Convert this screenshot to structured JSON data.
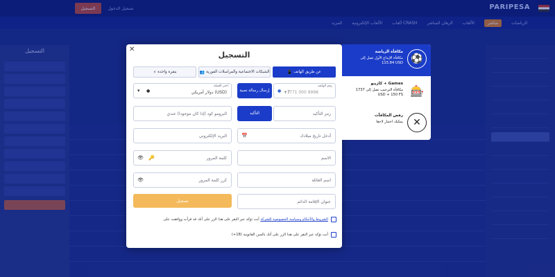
{
  "header": {
    "brand": "PARIPESA",
    "signup_label": "التسجيل",
    "login_label": "تسجيل الدخول"
  },
  "nav": {
    "items": [
      "الرياضات",
      "مباشر",
      "الألعاب",
      "الرهان المباشر",
      "ألعاب CRASH",
      "الألعاب الإلكترونية",
      "المزيد"
    ],
    "accent": "#d9822b"
  },
  "left_panel": {
    "title": "التسجيل"
  },
  "modal": {
    "title": "التسجيل",
    "close_icon": "close-icon",
    "tabs": [
      {
        "label": "عن طريق الهاتف",
        "icon": "phone-icon",
        "active": true
      },
      {
        "label": "الشبكات الاجتماعية والمراسلات الفورية",
        "icon": "users-icon",
        "active": false
      },
      {
        "label": "بنقرة واحدة",
        "icon": "bolt-icon",
        "active": false
      }
    ],
    "phone": {
      "label": "رقم الهاتف",
      "placeholder": "771 000 9998",
      "code": "+7"
    },
    "send_sms_label": "إرسال رسالة نصية",
    "currency": {
      "label": "اختر العملة",
      "value": "دولار أمريكي (USD)"
    },
    "confirm_code": {
      "placeholder": "رمز التأكيد"
    },
    "confirm_button_label": "التأكيد",
    "promo_code": {
      "placeholder": "البرومو كود (إذا كان موجودا) عندي"
    },
    "birthdate": {
      "placeholder": "أدخل تاريخ ميلادك"
    },
    "email": {
      "placeholder": "البريد الإلكتروني"
    },
    "first_name": {
      "placeholder": "الاسم"
    },
    "password": {
      "placeholder": "كلمة المرور"
    },
    "last_name": {
      "placeholder": "اسم العائلة"
    },
    "repeat_password": {
      "placeholder": "كرر كلمة المرور"
    },
    "address": {
      "placeholder": "عنوان الإقامة الدائم"
    },
    "register_button_label": "تسجيل",
    "terms": {
      "text": "أنت تؤكد عبر النقر على هذا الزر على أنك قد قرأت ووافقت على",
      "link": "الشروط والأحكام وسياسة الخصوصية للشركة"
    },
    "age": {
      "text": "أنت تؤكد عبر النقر على هذا الزر على أنك بالسن القانونية (18+)"
    }
  },
  "bonus": {
    "cards": [
      {
        "title": "مكافأة الرياضة",
        "desc": "مكافأة الإيداع الأول تصل إلى 115.84 USD",
        "icon": "soccer-ball-icon",
        "active": true
      },
      {
        "title": "كازينو + Games",
        "desc": "مكافأة الترحيب تصل إلى 1737 USD + 150 FS",
        "icon": "casino-chip-icon",
        "active": false
      },
      {
        "title": "رفض المكافآت",
        "desc": "يمكنك اختيار لاحقا",
        "icon": "x-circle-icon",
        "active": false
      }
    ],
    "active_color": "#1b3cc9"
  }
}
